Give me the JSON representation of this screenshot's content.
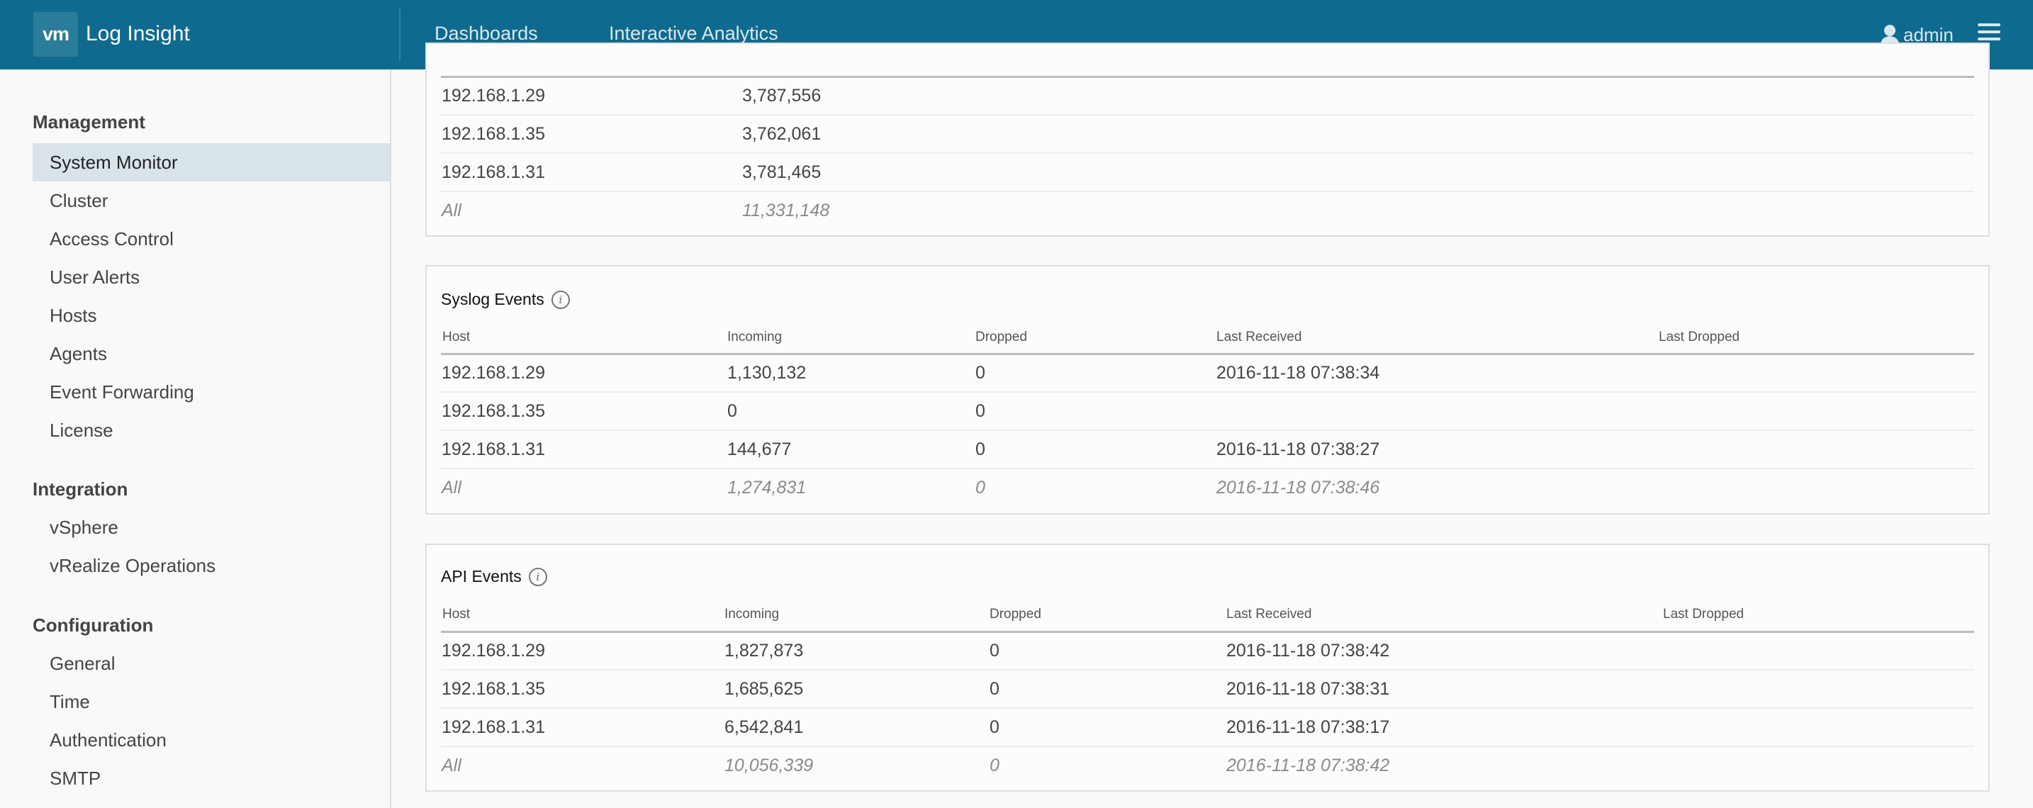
{
  "header": {
    "logo": "vm",
    "app_title": "Log Insight",
    "nav": [
      "Dashboards",
      "Interactive Analytics"
    ],
    "user": "admin",
    "colors": {
      "header_bg": "#0f6a8f",
      "active_sidebar_bg": "#d9e4ea"
    }
  },
  "sidebar": {
    "sections": [
      {
        "title": "Management",
        "items": [
          "System Monitor",
          "Cluster",
          "Access Control",
          "User Alerts",
          "Hosts",
          "Agents",
          "Event Forwarding",
          "License"
        ]
      },
      {
        "title": "Integration",
        "items": [
          "vSphere",
          "vRealize Operations"
        ]
      },
      {
        "title": "Configuration",
        "items": [
          "General",
          "Time",
          "Authentication",
          "SMTP"
        ]
      }
    ],
    "active_item": "System Monitor"
  },
  "top_table": {
    "rows": [
      [
        "192.168.1.29",
        "3,787,556"
      ],
      [
        "192.168.1.35",
        "3,762,061"
      ],
      [
        "192.168.1.31",
        "3,781,465"
      ]
    ],
    "total": [
      "All",
      "11,331,148"
    ]
  },
  "syslog": {
    "title": "Syslog Events",
    "columns": [
      "Host",
      "Incoming",
      "Dropped",
      "Last Received",
      "Last Dropped"
    ],
    "rows": [
      [
        "192.168.1.29",
        "1,130,132",
        "0",
        "2016-11-18 07:38:34",
        ""
      ],
      [
        "192.168.1.35",
        "0",
        "0",
        "",
        ""
      ],
      [
        "192.168.1.31",
        "144,677",
        "0",
        "2016-11-18 07:38:27",
        ""
      ]
    ],
    "total": [
      "All",
      "1,274,831",
      "0",
      "2016-11-18 07:38:46",
      ""
    ]
  },
  "api": {
    "title": "API Events",
    "columns": [
      "Host",
      "Incoming",
      "Dropped",
      "Last Received",
      "Last Dropped"
    ],
    "rows": [
      [
        "192.168.1.29",
        "1,827,873",
        "0",
        "2016-11-18 07:38:42",
        ""
      ],
      [
        "192.168.1.35",
        "1,685,625",
        "0",
        "2016-11-18 07:38:31",
        ""
      ],
      [
        "192.168.1.31",
        "6,542,841",
        "0",
        "2016-11-18 07:38:17",
        ""
      ]
    ],
    "total": [
      "All",
      "10,056,339",
      "0",
      "2016-11-18 07:38:42",
      ""
    ]
  }
}
